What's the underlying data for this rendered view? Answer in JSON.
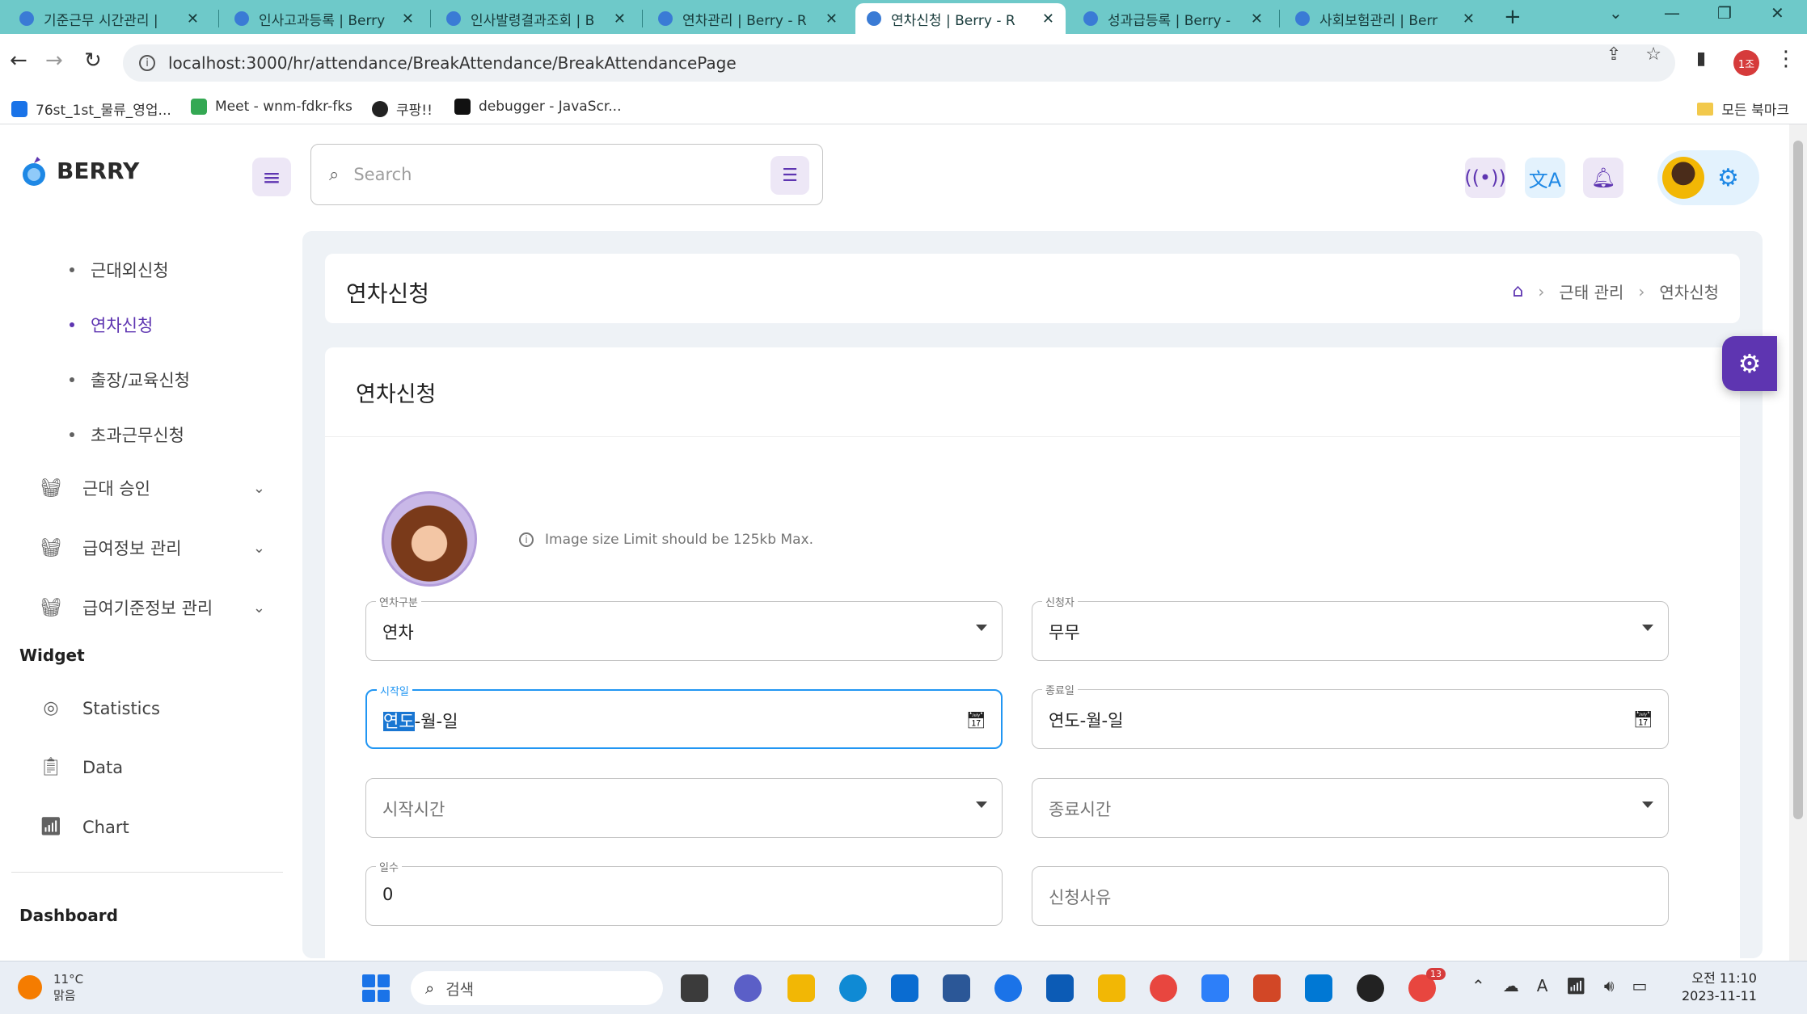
{
  "browser": {
    "tabs": [
      {
        "title": "기준근무 시간관리 |"
      },
      {
        "title": "인사고과등록 | Berry"
      },
      {
        "title": "인사발령결과조회 | B"
      },
      {
        "title": "연차관리 | Berry - R"
      },
      {
        "title": "연차신청 | Berry - R"
      },
      {
        "title": "성과급등록 | Berry -"
      },
      {
        "title": "사회보험관리 | Berr"
      }
    ],
    "url": "localhost:3000/hr/attendance/BreakAttendance/BreakAttendancePage",
    "profile_initials": "1조",
    "bookmarks": [
      "76st_1st_물류_영업...",
      "Meet - wnm-fdkr-fks",
      "쿠팡!!",
      "debugger - JavaScr..."
    ],
    "all_bookmarks": "모든 북마크"
  },
  "app": {
    "brand": "BERRY",
    "search_placeholder": "Search"
  },
  "sidebar": {
    "sub_items": [
      {
        "label": "근대외신청",
        "active": false
      },
      {
        "label": "연차신청",
        "active": true
      },
      {
        "label": "출장/교육신청",
        "active": false
      },
      {
        "label": "초과근무신청",
        "active": false
      }
    ],
    "groups": [
      {
        "label": "근대 승인"
      },
      {
        "label": "급여정보 관리"
      },
      {
        "label": "급여기준정보 관리"
      }
    ],
    "widget_title": "Widget",
    "widget_items": [
      {
        "label": "Statistics"
      },
      {
        "label": "Data"
      },
      {
        "label": "Chart"
      }
    ],
    "dashboard_title": "Dashboard"
  },
  "page": {
    "title": "연차신청",
    "breadcrumb": [
      "근태 관리",
      "연차신청"
    ]
  },
  "form": {
    "title": "연차신청",
    "image_note": "Image size Limit should be 125kb Max.",
    "fields": {
      "leave_type": {
        "label": "연차구분",
        "value": "연차"
      },
      "applicant": {
        "label": "신청자",
        "value": "무무"
      },
      "start_date": {
        "label": "시작일",
        "value_year": "연도",
        "value_rest": "-월-일"
      },
      "end_date": {
        "label": "종료일",
        "value": "연도-월-일"
      },
      "start_time": {
        "placeholder": "시작시간"
      },
      "end_time": {
        "placeholder": "종료시간"
      },
      "days": {
        "label": "일수",
        "value": "0"
      },
      "reason": {
        "placeholder": "신청사유"
      }
    }
  },
  "taskbar": {
    "temperature": "11°C",
    "weather": "맑음",
    "search_label": "검색",
    "time": "오전 11:10",
    "date": "2023-11-11",
    "chrome_badge": "13"
  },
  "colors": {
    "primary": "#5e35b1",
    "focus": "#2196f3",
    "tabstrip": "#6ec9c9"
  }
}
